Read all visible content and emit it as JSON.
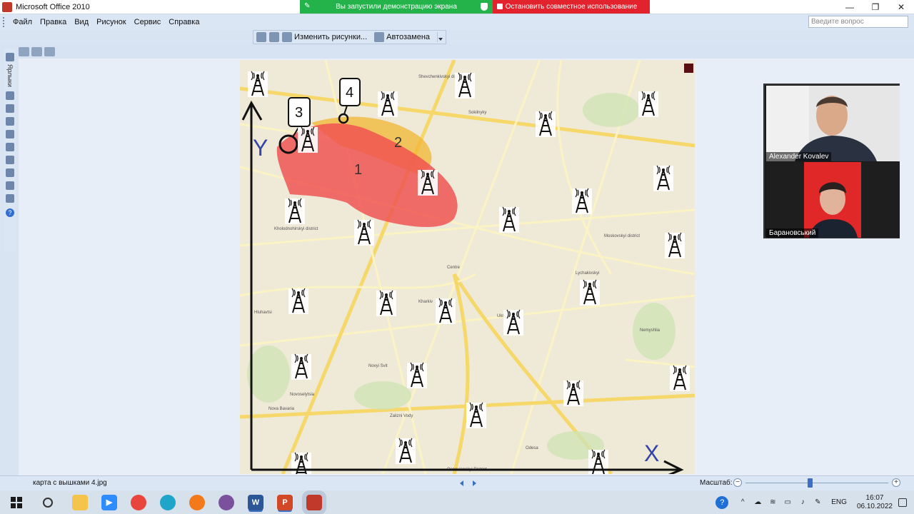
{
  "window": {
    "title": "Microsoft Office 2010",
    "minimize": "—",
    "maximize": "❐",
    "close": "✕"
  },
  "share_banner": {
    "sharing_text": "Вы запустили демонстрацию экрана",
    "stop_text": "Остановить совместное использование",
    "sharing_color": "#23b34a",
    "stop_color": "#e2222c"
  },
  "menu": {
    "items": [
      "Файл",
      "Правка",
      "Вид",
      "Рисунок",
      "Сервис",
      "Справка"
    ],
    "ask_placeholder": "Введите вопрос"
  },
  "picture_toolbar": {
    "edit_pictures": "Изменить рисунки...",
    "autocorrect": "Автозамена"
  },
  "left_toolbar": {
    "label": "Ярлыки"
  },
  "map": {
    "axis_y": "Y",
    "axis_x": "X",
    "zone_labels": [
      "1",
      "2"
    ],
    "callouts": [
      "3",
      "4"
    ],
    "zone_colors": {
      "zone1": "#ef4f4f",
      "zone2": "#f2b531"
    },
    "tower_icon": "cell-tower-icon",
    "district_labels": [
      "Kholodnohirskyi district",
      "Novoselytsia",
      "Zalizni Vody",
      "Moskovskyi district",
      "Centre",
      "Kharkiv",
      "Ukrainka",
      "Lychakivskyi",
      "Odesa",
      "Nova Bavaria",
      "Hluhavtsi",
      "Novyi Svit",
      "Osnovianskyi District",
      "Shevchenkivskyi district",
      "Sokilnyky",
      "Nemyshlia"
    ]
  },
  "video": {
    "participants": [
      {
        "name": "Alexander Kovalev"
      },
      {
        "name": "Барановський"
      }
    ]
  },
  "status": {
    "filename": "карта с вышками 4.jpg",
    "zoom_label": "Масштаб:",
    "zoom_level": 0.45
  },
  "taskbar": {
    "apps": [
      "file-explorer-icon",
      "zoom-icon",
      "chrome-icon",
      "edge-icon",
      "firefox-icon",
      "viber-icon",
      "word-icon",
      "powerpoint-icon",
      "picture-manager-icon"
    ],
    "lang": "ENG",
    "time": "16:07",
    "date": "06.10.2022"
  }
}
